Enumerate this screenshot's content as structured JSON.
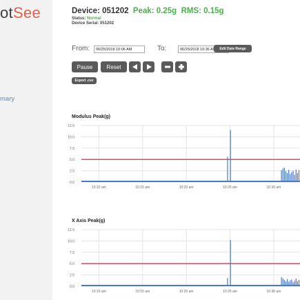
{
  "sidebar": {
    "logo_part1": "ot",
    "logo_part2": "See",
    "nav_item_summary": "mary"
  },
  "header": {
    "device_label": "Device: 051202",
    "peak_label": "Peak: 0.25g",
    "rms_label": "RMS: 0.15g",
    "status_label": "Status:",
    "status_value": "Normal",
    "serial_label": "Device Serial: 051202"
  },
  "date_range": {
    "from_label": "From:",
    "from_value": "06/25/2018 10:06 AM",
    "to_label": "To:",
    "to_value": "06/25/2018 10:36 AM",
    "edit_button": "Edit Date Range"
  },
  "controls": {
    "pause": "Pause",
    "reset": "Reset",
    "export": "Export .csv"
  },
  "colors": {
    "bar": "#4a78c8",
    "threshold": "#d33c5a",
    "grid": "#e3e3e3",
    "status_green": "#4cae4c"
  },
  "chart_data": [
    {
      "type": "bar",
      "title": "Modulus Peak(g)",
      "xlabel": "",
      "ylabel": "",
      "ylim": [
        0,
        12.5
      ],
      "y_ticks": [
        "0.0",
        "2.5",
        "5.0",
        "7.5",
        "10.0",
        "12.5"
      ],
      "x_ticks": [
        "10:10 am",
        "10:15 am",
        "10:20 am",
        "10:25 am",
        "10:30 am"
      ],
      "threshold": 5.0,
      "grid": true,
      "points": [
        {
          "t": "10:24:40",
          "v": 5.6
        },
        {
          "t": "10:25:00",
          "v": 11.5
        },
        {
          "t": "10:30:50",
          "v": 2.6
        },
        {
          "t": "10:31:00",
          "v": 3.0
        },
        {
          "t": "10:31:10",
          "v": 3.2
        },
        {
          "t": "10:31:20",
          "v": 2.4
        },
        {
          "t": "10:31:30",
          "v": 2.0
        },
        {
          "t": "10:31:40",
          "v": 2.7
        },
        {
          "t": "10:31:50",
          "v": 1.8
        },
        {
          "t": "10:32:00",
          "v": 2.2
        },
        {
          "t": "10:32:10",
          "v": 2.5
        },
        {
          "t": "10:32:20",
          "v": 1.6
        },
        {
          "t": "10:32:30",
          "v": 2.8
        },
        {
          "t": "10:32:40",
          "v": 2.0
        },
        {
          "t": "10:32:50",
          "v": 2.6
        },
        {
          "t": "10:33:00",
          "v": 2.3
        }
      ]
    },
    {
      "type": "bar",
      "title": "X Axis Peak(g)",
      "xlabel": "",
      "ylabel": "",
      "ylim": [
        0,
        12.5
      ],
      "y_ticks": [
        "0.0",
        "2.5",
        "5.0",
        "7.5",
        "10.0",
        "12.5"
      ],
      "x_ticks": [
        "10:10 am",
        "10:15 am",
        "10:20 am",
        "10:25 am",
        "10:30 am"
      ],
      "threshold": 5.0,
      "grid": true,
      "points": [
        {
          "t": "10:24:40",
          "v": 1.8
        },
        {
          "t": "10:25:00",
          "v": 10.2
        },
        {
          "t": "10:30:50",
          "v": 2.0
        },
        {
          "t": "10:31:00",
          "v": 1.7
        },
        {
          "t": "10:31:10",
          "v": 1.4
        },
        {
          "t": "10:31:20",
          "v": 1.1
        },
        {
          "t": "10:31:30",
          "v": 1.6
        },
        {
          "t": "10:31:40",
          "v": 1.0
        },
        {
          "t": "10:31:50",
          "v": 1.3
        },
        {
          "t": "10:32:00",
          "v": 1.5
        },
        {
          "t": "10:32:10",
          "v": 0.9
        },
        {
          "t": "10:32:20",
          "v": 1.2
        },
        {
          "t": "10:32:30",
          "v": 1.7
        },
        {
          "t": "10:32:40",
          "v": 1.1
        },
        {
          "t": "10:32:50",
          "v": 1.4
        },
        {
          "t": "10:33:00",
          "v": 1.2
        }
      ]
    }
  ]
}
